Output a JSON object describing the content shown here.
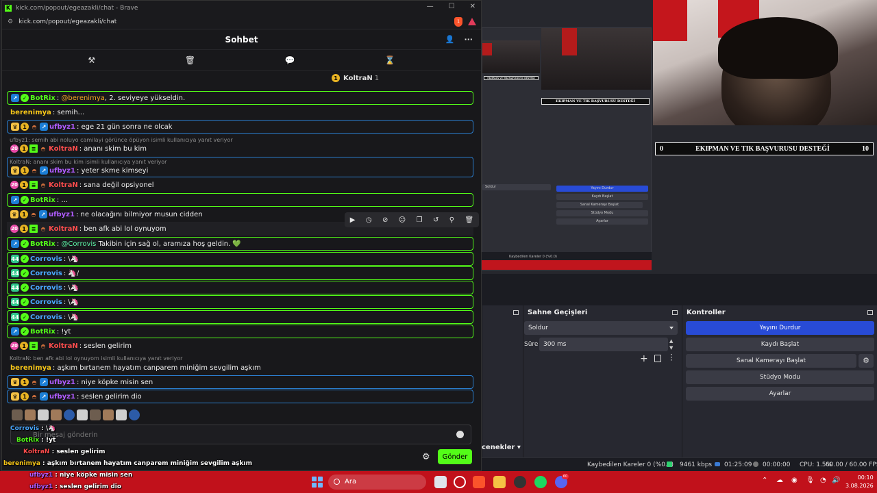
{
  "browser": {
    "title": "kick.com/popout/egeazakli/chat - Brave",
    "url": "kick.com/popout/egeazakli/chat",
    "brave_count": "1"
  },
  "chat": {
    "header": "Sohbet",
    "pinned_user": "KoltraN",
    "pinned_count": "1",
    "input_placeholder": "Bir mesaj gönderin",
    "send_label": "Gönder",
    "messages": [
      {
        "user": "BotRix",
        "text": "@berenimya, 2. seviyeye yükseldin.",
        "mention": "@berenimya"
      },
      {
        "user": "berenimya",
        "text": "semih..."
      },
      {
        "user": "ufbyz1",
        "text": "ege 21 gün sonra ne olcak"
      },
      {
        "reply": "ufbyz1: semih abi noluyo camilayi görünce öpüyon isimli kullanıcıya yanıt veriyor"
      },
      {
        "user": "KoltraN",
        "text": "ananı skim bu kim"
      },
      {
        "reply": "KoltraN: ananı skim bu kim isimli kullanıcıya yanıt veriyor"
      },
      {
        "user": "ufbyz1",
        "text": "yeter skme kimseyi"
      },
      {
        "user": "KoltraN",
        "text": "sana değil opsiyonel"
      },
      {
        "user": "BotRix",
        "text": "..."
      },
      {
        "user": "ufbyz1",
        "text": "ne olacağını bilmiyor musun cidden"
      },
      {
        "user": "KoltraN",
        "text": "ben afk abi lol oynuyom"
      },
      {
        "user": "BotRix",
        "text": "Takibin için sağ ol, aramıza hoş geldin. 💚",
        "mention": "@Corrovis"
      },
      {
        "user": "Corrovis",
        "text": "\\🦄"
      },
      {
        "user": "Corrovis",
        "text": "🦄/"
      },
      {
        "user": "Corrovis",
        "text": "\\🦄"
      },
      {
        "user": "Corrovis",
        "text": "\\🦄"
      },
      {
        "user": "Corrovis",
        "text": "\\🦄"
      },
      {
        "user": "BotRix",
        "text": "!yt"
      },
      {
        "user": "KoltraN",
        "text": "seslen gelirim"
      },
      {
        "reply": "KoltraN: ben afk abi lol oynuyom isimli kullanıcıya yanıt veriyor"
      },
      {
        "user": "berenimya",
        "text": "aşkım bırtanem hayatım canparem miniğim sevgilim aşkım"
      },
      {
        "user": "ufbyz1",
        "text": "niye köpke misin sen"
      },
      {
        "user": "ufbyz1",
        "text": "seslen gelirim dio"
      }
    ]
  },
  "overlay_chat": [
    {
      "user": "Corrovis",
      "text": "\\🦄"
    },
    {
      "user": "BotRix",
      "text": "!yt"
    },
    {
      "user": "KoltraN",
      "text": "seslen gelirim"
    },
    {
      "user": "berenimya",
      "text": "aşkım bırtanem hayatım canparem miniğim sevgilim aşkım"
    },
    {
      "user": "ufbyz1",
      "text": "niye köpke misin sen"
    },
    {
      "user": "ufbyz1",
      "text": "seslen gelirim dio"
    }
  ],
  "stream": {
    "info_left": "0",
    "info_title": "EKIPMAN VE TIK BAŞVURUSU DESTEĞİ",
    "info_right": "10"
  },
  "obs": {
    "transitions_title": "Sahne Geçişleri",
    "transition_value": "Soldur",
    "duration_label": "Süre",
    "duration_value": "300 ms",
    "controls_title": "Kontroller",
    "controls": {
      "stop_stream": "Yayını Durdur",
      "start_recording": "Kaydı Başlat",
      "virtual_camera": "Sanal Kamerayı Başlat",
      "studio_mode": "Stüdyo Modu",
      "settings": "Ayarlar"
    },
    "dock_tab": "cenekler",
    "status": {
      "dropped": "Kaybedilen Kareler 0 (%0.0)",
      "bitrate": "9461 kbps",
      "stream_time": "01:25:09",
      "rec_time": "00:00:00",
      "cpu": "CPU: 1.5%",
      "fps": "60.00 / 60.00 FPS"
    }
  },
  "taskbar": {
    "search_label": "Ara",
    "time": "00:10",
    "date": "3.08.2026",
    "discord_badge": "60"
  },
  "colors": {
    "kick_green": "#53fc18",
    "obs_blue": "#284bd6",
    "taskbar_red": "#c1111b"
  }
}
